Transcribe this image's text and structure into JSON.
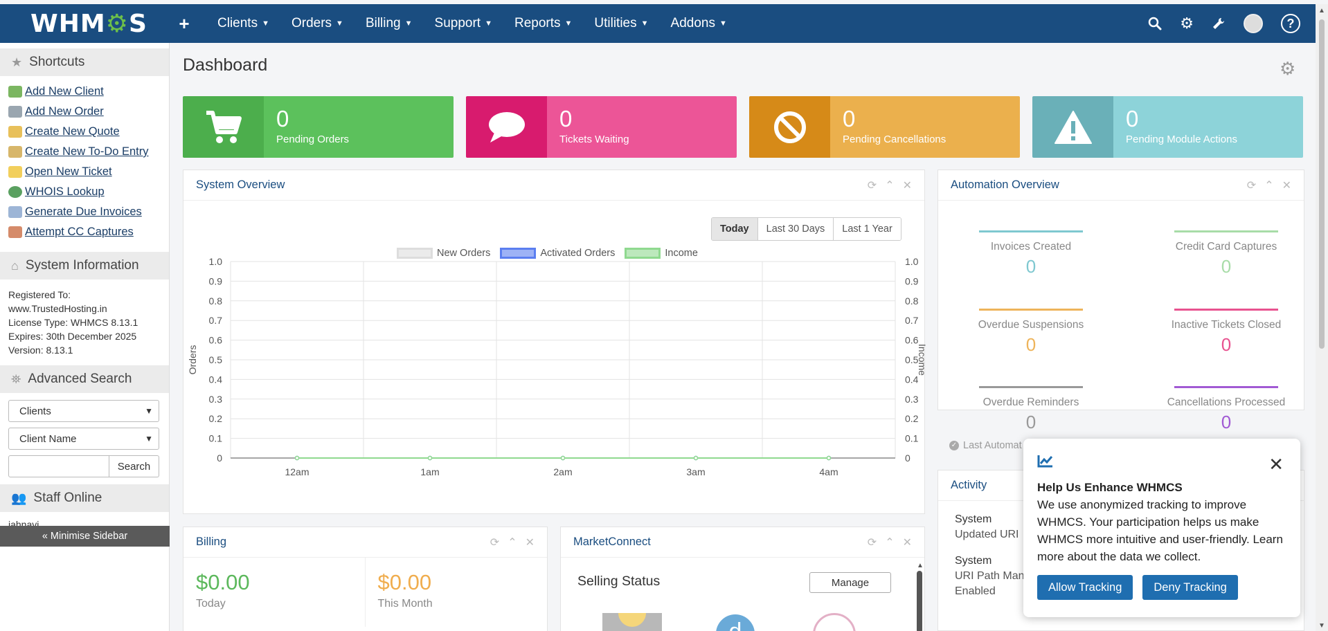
{
  "topbar": {
    "logo_text": "WHMCS",
    "nav": [
      "Clients",
      "Orders",
      "Billing",
      "Support",
      "Reports",
      "Utilities",
      "Addons"
    ]
  },
  "sidebar": {
    "shortcuts_title": "Shortcuts",
    "shortcuts": [
      "Add New Client",
      "Add New Order",
      "Create New Quote",
      "Create New To-Do Entry",
      "Open New Ticket",
      "WHOIS Lookup",
      "Generate Due Invoices",
      "Attempt CC Captures"
    ],
    "system_info_title": "System Information",
    "system_info": [
      "Registered To:",
      "www.TrustedHosting.in",
      "License Type: WHMCS 8.13.1",
      "Expires: 30th December 2025",
      "Version: 8.13.1"
    ],
    "advanced_search_title": "Advanced Search",
    "search_type": "Clients",
    "search_field": "Client Name",
    "search_button": "Search",
    "staff_online_title": "Staff Online",
    "staff_online": "jahnavi",
    "minimise": "« Minimise Sidebar"
  },
  "main": {
    "title": "Dashboard",
    "stats": [
      {
        "value": "0",
        "label": "Pending Orders",
        "color_icon": "#4cae4c",
        "color": "#5cc15c",
        "icon": "cart-icon"
      },
      {
        "value": "0",
        "label": "Tickets Waiting",
        "color_icon": "#d81b6e",
        "color": "#ec5597",
        "icon": "comment-icon"
      },
      {
        "value": "0",
        "label": "Pending Cancellations",
        "color_icon": "#d68a18",
        "color": "#ebb04d",
        "icon": "ban-icon"
      },
      {
        "value": "0",
        "label": "Pending Module Actions",
        "color_icon": "#6ab0b8",
        "color": "#8dd3d9",
        "icon": "warning-icon"
      }
    ]
  },
  "system_overview": {
    "title": "System Overview",
    "ranges": [
      "Today",
      "Last 30 Days",
      "Last 1 Year"
    ],
    "legend": [
      "New Orders",
      "Activated Orders",
      "Income"
    ],
    "legend_colors": [
      "#dddddd",
      "#5b7ef0",
      "#8fd98f"
    ],
    "left_axis_label": "Orders",
    "right_axis_label": "Income"
  },
  "chart_data": {
    "type": "line",
    "categories": [
      "12am",
      "1am",
      "2am",
      "3am",
      "4am"
    ],
    "series": [
      {
        "name": "New Orders",
        "values": [
          0,
          0,
          0,
          0,
          0
        ]
      },
      {
        "name": "Activated Orders",
        "values": [
          0,
          0,
          0,
          0,
          0
        ]
      },
      {
        "name": "Income",
        "values": [
          0,
          0,
          0,
          0,
          0
        ]
      }
    ],
    "ylabel": "Orders",
    "y2label": "Income",
    "ylim": [
      0,
      1.0
    ],
    "yticks": [
      "0",
      "0.1",
      "0.2",
      "0.3",
      "0.4",
      "0.5",
      "0.6",
      "0.7",
      "0.8",
      "0.9",
      "1.0"
    ],
    "grid": true,
    "legend": "top-center"
  },
  "automation": {
    "title": "Automation Overview",
    "items": [
      {
        "label": "Invoices Created",
        "value": "0",
        "color": "#7fc8d0"
      },
      {
        "label": "Credit Card Captures",
        "value": "0",
        "color": "#a8dca8"
      },
      {
        "label": "Overdue Suspensions",
        "value": "0",
        "color": "#eeb45a"
      },
      {
        "label": "Inactive Tickets Closed",
        "value": "0",
        "color": "#e8528f"
      },
      {
        "label": "Overdue Reminders",
        "value": "0",
        "color": "#999999"
      },
      {
        "label": "Cancellations Processed",
        "value": "0",
        "color": "#a15ad4"
      }
    ],
    "last_run": "Last Automat"
  },
  "billing": {
    "title": "Billing",
    "today_value": "$0.00",
    "today_label": "Today",
    "month_value": "$0.00",
    "month_label": "This Month"
  },
  "marketconnect": {
    "title": "MarketConnect",
    "selling_status": "Selling Status",
    "manage": "Manage"
  },
  "activity": {
    "title": "Activity",
    "entries": [
      {
        "who": "System",
        "what": "Updated URI"
      },
      {
        "who": "System",
        "what": "URI Path Man",
        "extra": "Enabled"
      }
    ]
  },
  "popup": {
    "title": "Help Us Enhance WHMCS",
    "text": "We use anonymized tracking to improve WHMCS. Your participation helps us make WHMCS more intuitive and user-friendly. Learn more about the data we collect.",
    "allow": "Allow Tracking",
    "deny": "Deny Tracking"
  }
}
